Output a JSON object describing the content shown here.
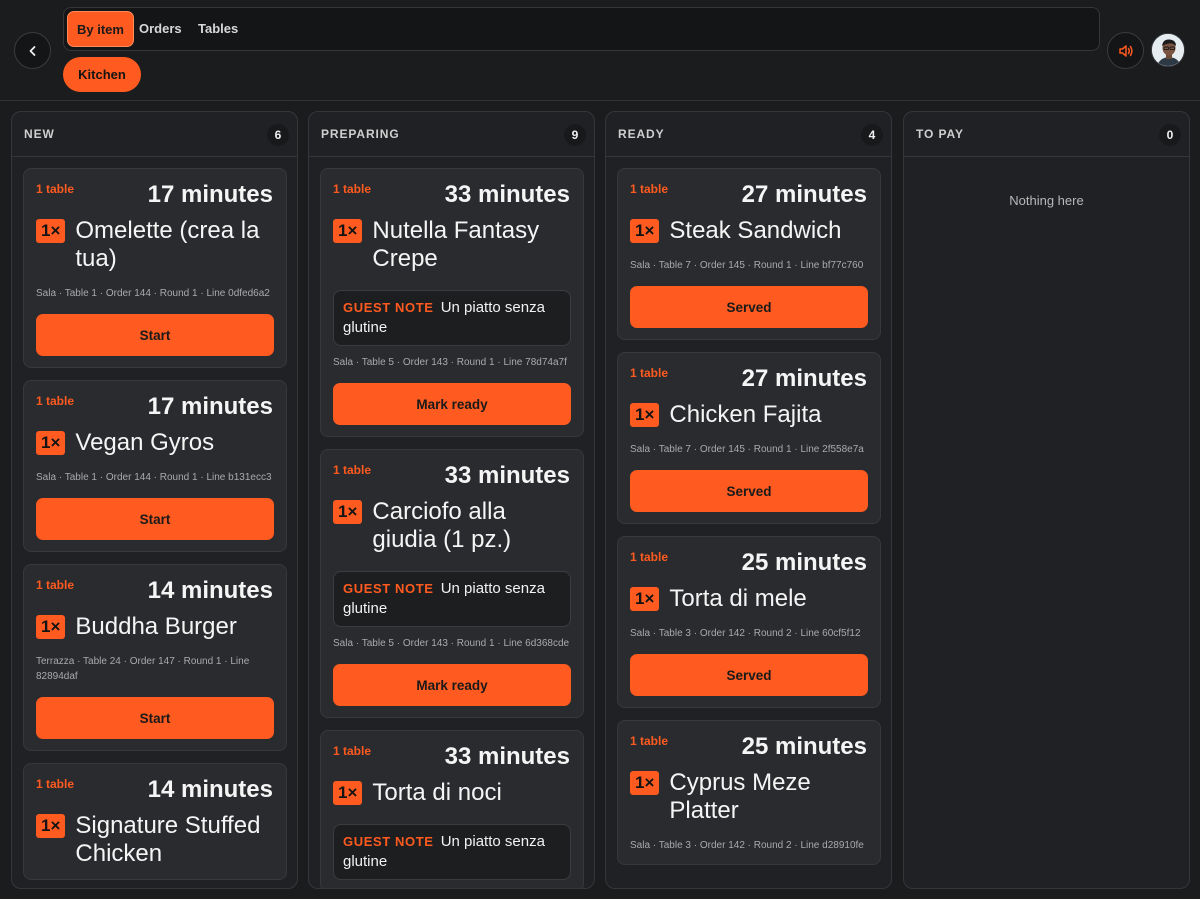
{
  "header": {
    "back_label": "Back",
    "tabs": [
      "By item",
      "Orders",
      "Tables"
    ],
    "active_tab": "By item",
    "station": "Kitchen"
  },
  "columns": [
    {
      "title": "NEW",
      "count": "6",
      "empty_text": "",
      "cards": [
        {
          "tables": "1 table",
          "elapsed": "17 minutes",
          "qty": "1×",
          "item": "Omelette (crea la tua)",
          "note": "",
          "meta": "Sala · Table 1 · Order 144 · Round 1 · Line 0dfed6a2",
          "action": "Start"
        },
        {
          "tables": "1 table",
          "elapsed": "17 minutes",
          "qty": "1×",
          "item": "Vegan Gyros",
          "note": "",
          "meta": "Sala · Table 1 · Order 144 · Round 1 · Line b131ecc3",
          "action": "Start"
        },
        {
          "tables": "1 table",
          "elapsed": "14 minutes",
          "qty": "1×",
          "item": "Buddha Burger",
          "note": "",
          "meta": "Terrazza · Table 24 · Order 147 · Round 1 · Line 82894daf",
          "action": "Start"
        },
        {
          "tables": "1 table",
          "elapsed": "14 minutes",
          "qty": "1×",
          "item": "Signature Stuffed Chicken",
          "note": "",
          "meta": "",
          "action": ""
        }
      ]
    },
    {
      "title": "PREPARING",
      "count": "9",
      "empty_text": "",
      "cards": [
        {
          "tables": "1 table",
          "elapsed": "33 minutes",
          "qty": "1×",
          "item": "Nutella Fantasy Crepe",
          "note_label": "GUEST NOTE",
          "note": "Un piatto senza glutine",
          "meta": "Sala · Table 5 · Order 143 · Round 1 · Line 78d74a7f",
          "action": "Mark ready"
        },
        {
          "tables": "1 table",
          "elapsed": "33 minutes",
          "qty": "1×",
          "item": "Carciofo alla giudia (1 pz.)",
          "note_label": "GUEST NOTE",
          "note": "Un piatto senza glutine",
          "meta": "Sala · Table 5 · Order 143 · Round 1 · Line 6d368cde",
          "action": "Mark ready"
        },
        {
          "tables": "1 table",
          "elapsed": "33 minutes",
          "qty": "1×",
          "item": "Torta di noci",
          "note_label": "GUEST NOTE",
          "note": "Un piatto senza glutine",
          "meta": "",
          "action": ""
        }
      ]
    },
    {
      "title": "READY",
      "count": "4",
      "empty_text": "",
      "cards": [
        {
          "tables": "1 table",
          "elapsed": "27 minutes",
          "qty": "1×",
          "item": "Steak Sandwich",
          "note": "",
          "meta": "Sala · Table 7 · Order 145 · Round 1 · Line bf77c760",
          "action": "Served"
        },
        {
          "tables": "1 table",
          "elapsed": "27 minutes",
          "qty": "1×",
          "item": "Chicken Fajita",
          "note": "",
          "meta": "Sala · Table 7 · Order 145 · Round 1 · Line 2f558e7a",
          "action": "Served"
        },
        {
          "tables": "1 table",
          "elapsed": "25 minutes",
          "qty": "1×",
          "item": "Torta di mele",
          "note": "",
          "meta": "Sala · Table 3 · Order 142 · Round 2 · Line 60cf5f12",
          "action": "Served"
        },
        {
          "tables": "1 table",
          "elapsed": "25 minutes",
          "qty": "1×",
          "item": "Cyprus Meze Platter",
          "note": "",
          "meta": "Sala · Table 3 · Order 142 · Round 2 · Line d28910fe",
          "action": ""
        }
      ]
    },
    {
      "title": "TO PAY",
      "count": "0",
      "empty_text": "Nothing here",
      "cards": []
    }
  ],
  "colors": {
    "accent": "#ff5a1f",
    "background": "#1b1c1e",
    "column": "#202124",
    "card": "#2a2b2e"
  },
  "icons": {
    "back": "chevron-left-icon",
    "sound": "speaker-icon",
    "avatar": "user-avatar"
  }
}
